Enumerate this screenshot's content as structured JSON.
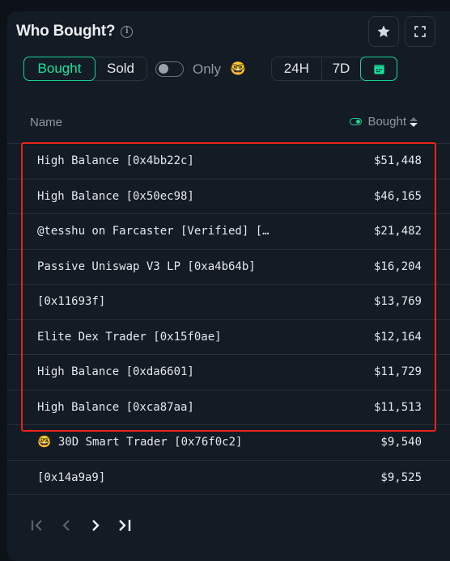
{
  "header": {
    "title": "Who Bought?",
    "info_icon": "info-icon",
    "favorite_icon": "star-icon",
    "expand_icon": "fullscreen-icon"
  },
  "tabs": {
    "items": [
      {
        "label": "Bought",
        "active": true
      },
      {
        "label": "Sold",
        "active": false
      }
    ]
  },
  "filter": {
    "toggle_on": false,
    "label": "Only",
    "emoji": "🤓"
  },
  "range": {
    "items": [
      {
        "label": "24H",
        "active": false
      },
      {
        "label": "7D",
        "active": false
      },
      {
        "label": "calendar-icon",
        "active": true
      }
    ]
  },
  "table": {
    "columns": {
      "name": "Name",
      "value": "Bought"
    },
    "rows": [
      {
        "name": "High Balance [0x4bb22c]",
        "value": "$51,448"
      },
      {
        "name": "High Balance [0x50ec98]",
        "value": "$46,165"
      },
      {
        "name": "@tesshu on Farcaster [Verified] […",
        "value": "$21,482"
      },
      {
        "name": "Passive Uniswap V3 LP [0xa4b64b]",
        "value": "$16,204"
      },
      {
        "name": "[0x11693f]",
        "value": "$13,769"
      },
      {
        "name": "Elite Dex Trader [0x15f0ae]",
        "value": "$12,164"
      },
      {
        "name": "High Balance [0xda6601]",
        "value": "$11,729"
      },
      {
        "name": "High Balance [0xca87aa]",
        "value": "$11,513"
      },
      {
        "name": "🤓 30D Smart Trader [0x76f0c2]",
        "value": "$9,540"
      },
      {
        "name": "[0x14a9a9]",
        "value": "$9,525"
      }
    ]
  },
  "pagination": {
    "first": "first-page-icon",
    "prev": "previous-page-icon",
    "next": "next-page-icon",
    "last": "last-page-icon"
  },
  "colors": {
    "accent": "#19d392",
    "highlight": "#e8231b",
    "background": "#131b25"
  }
}
